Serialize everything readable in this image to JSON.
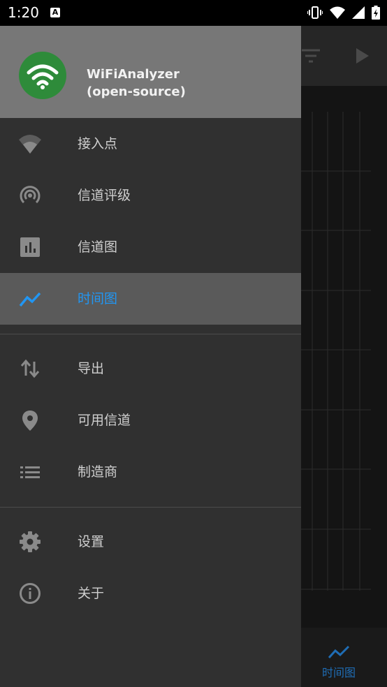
{
  "status_bar": {
    "time": "1:20",
    "notification_letter": "A"
  },
  "drawer": {
    "app_name_line1": "WiFiAnalyzer",
    "app_name_line2": "(open-source)",
    "menu_group1": [
      {
        "label": "接入点",
        "icon": "wifi-icon"
      },
      {
        "label": "信道评级",
        "icon": "channel-rating-icon"
      },
      {
        "label": "信道图",
        "icon": "bar-chart-icon"
      },
      {
        "label": "时间图",
        "icon": "timeline-icon",
        "active": true
      }
    ],
    "menu_group2": [
      {
        "label": "导出",
        "icon": "export-icon"
      },
      {
        "label": "可用信道",
        "icon": "location-pin-icon"
      },
      {
        "label": "制造商",
        "icon": "list-icon"
      }
    ],
    "menu_group3": [
      {
        "label": "设置",
        "icon": "gear-icon"
      },
      {
        "label": "关于",
        "icon": "info-icon"
      }
    ]
  },
  "background_app": {
    "bottom_tab_label": "时间图"
  },
  "colors": {
    "accent": "#2196f3",
    "drawer_bg": "#303030",
    "header_bg": "#777777",
    "logo_green": "#2e8b3a"
  }
}
